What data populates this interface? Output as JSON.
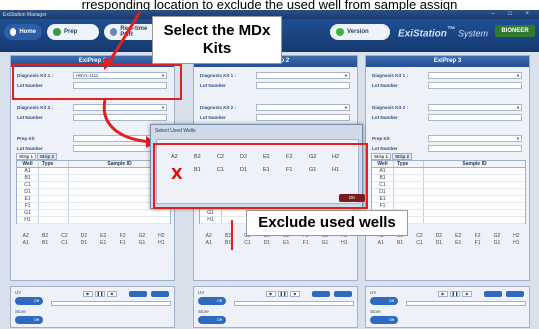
{
  "caption": "rresponding location to exclude the used well from sample assign",
  "window": {
    "title": "ExiStation Manager"
  },
  "toolbar": {
    "home": "Home",
    "prep": "Prep",
    "pcr": "Real-time PCR",
    "version": "Version",
    "brand": "ExiStation",
    "brand_suffix": "System",
    "logo": "BIONEER"
  },
  "panels": [
    {
      "title": "ExiPrep 1",
      "kit1_value": "HBV1-1111"
    },
    {
      "title": "ExiPrep 2",
      "kit1_value": ""
    },
    {
      "title": "ExiPrep 3",
      "kit1_value": ""
    }
  ],
  "labels": {
    "kit1": "Diagnosis Kit 1 :",
    "lot": "Lot Number",
    "kit2": "Diagnosis Kit 2 :",
    "prep_kit": "Prep Kit",
    "strip1": "Strip 1",
    "strip2": "Strip 2",
    "col_well": "Well",
    "col_type": "Type",
    "col_sample": "Sample ID",
    "uv": "UV",
    "store": "Store",
    "toggle": "Off"
  },
  "wells": [
    "A1",
    "B1",
    "C1",
    "D1",
    "E1",
    "F1",
    "G1",
    "H1"
  ],
  "grid_top": [
    "A2",
    "B2",
    "C2",
    "D2",
    "E2",
    "F2",
    "G2",
    "H2"
  ],
  "grid_bottom": [
    "A1",
    "B1",
    "C1",
    "D1",
    "E1",
    "F1",
    "G1",
    "H1"
  ],
  "dialog": {
    "title": "Select Used Wells",
    "top": [
      "A2",
      "B2",
      "C2",
      "D2",
      "E2",
      "F2",
      "G2",
      "H2"
    ],
    "bottom": [
      "B1",
      "C1",
      "D1",
      "E1",
      "F1",
      "G1",
      "H1"
    ],
    "mark": "X",
    "ok": "OK"
  },
  "callouts": {
    "select_kits": "Select the MDx Kits",
    "exclude": "Exclude used wells"
  },
  "colors": {
    "annotation": "#e32020",
    "header": "#1f4f93"
  }
}
